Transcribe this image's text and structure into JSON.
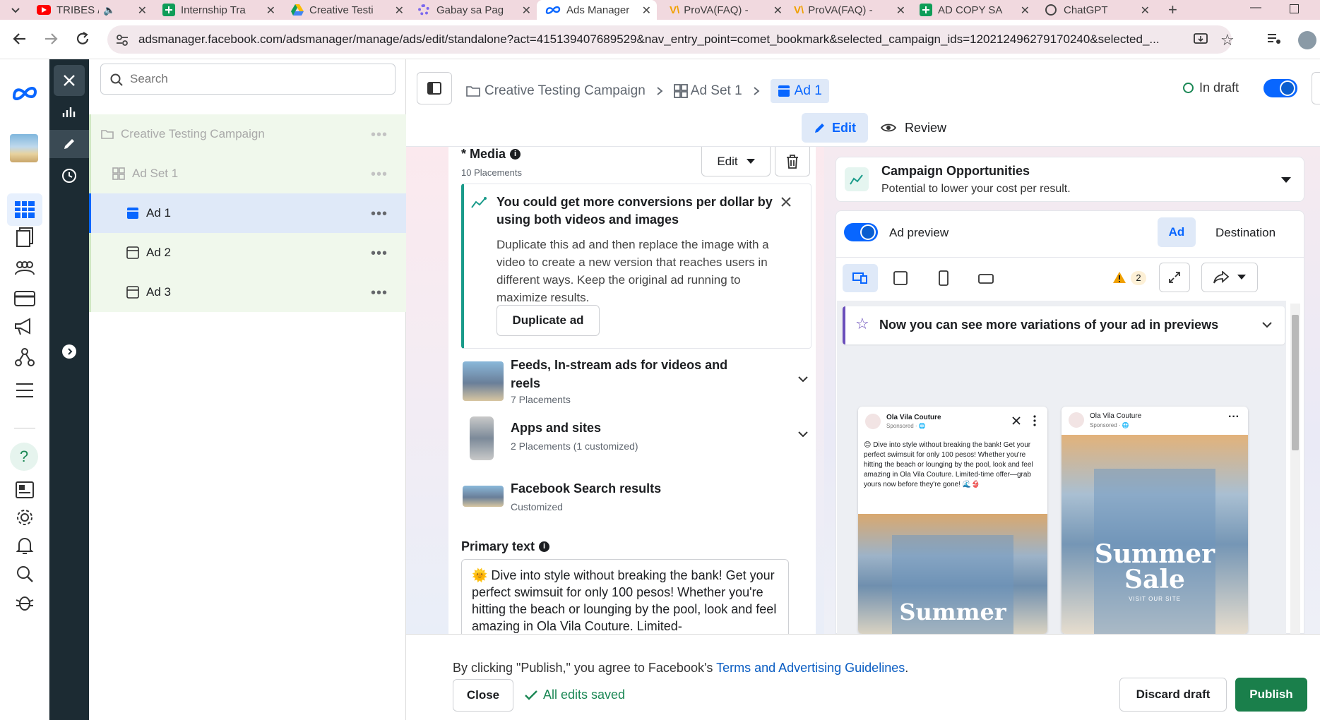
{
  "browser": {
    "tabs": [
      {
        "title": "TRIBES //",
        "icon": "youtube-icon",
        "color": "#ff0000"
      },
      {
        "title": "Internship Tra",
        "icon": "sheets-icon",
        "color": "#0f9d58"
      },
      {
        "title": "Creative Testi",
        "icon": "drive-icon",
        "color": "#fbbc04"
      },
      {
        "title": "Gabay sa Pag",
        "icon": "clickup-icon",
        "color": "#7b68ee"
      },
      {
        "title": "Ads Manager",
        "icon": "meta-icon",
        "color": "#0866ff"
      },
      {
        "title": "ProVA(FAQ) -",
        "icon": "prova-icon",
        "color": "#f0a000"
      },
      {
        "title": "ProVA(FAQ) -",
        "icon": "prova-icon",
        "color": "#f0a000"
      },
      {
        "title": "AD COPY SA",
        "icon": "sheets-icon",
        "color": "#0f9d58"
      },
      {
        "title": "ChatGPT",
        "icon": "chatgpt-icon",
        "color": "#444444"
      }
    ],
    "url": "adsmanager.facebook.com/adsmanager/manage/ads/edit/standalone?act=415139407689529&nav_entry_point=comet_bookmark&selected_campaign_ids=120212496279170240&selected_..."
  },
  "tree": {
    "search_placeholder": "Search",
    "campaign": "Creative Testing Campaign",
    "adset": "Ad Set 1",
    "ads": [
      "Ad 1",
      "Ad 2",
      "Ad 3"
    ],
    "more": "•••"
  },
  "breadcrumb": {
    "campaign": "Creative Testing Campaign",
    "adset": "Ad Set 1",
    "ad": "Ad 1",
    "status": "In draft"
  },
  "mode_tabs": {
    "edit": "Edit",
    "review": "Review"
  },
  "media": {
    "title": "* Media",
    "placements": "10 Placements",
    "edit_label": "Edit",
    "tip_title": "You could get more conversions per dollar by using both videos and images",
    "tip_body": "Duplicate this ad and then replace the image with a video to create a new version that reaches users in different ways. Keep the original ad running to maximize results.",
    "duplicate_label": "Duplicate ad",
    "groups": [
      {
        "title": "Feeds, In-stream ads for videos and reels",
        "sub": "7 Placements"
      },
      {
        "title": "Apps and sites",
        "sub": "2 Placements (1 customized)"
      },
      {
        "title": "Facebook Search results",
        "sub": "Customized"
      }
    ]
  },
  "primary_text": {
    "label": "Primary text",
    "value": "🌞 Dive into style without breaking the bank! Get your perfect swimsuit for only 100 pesos! Whether you're hitting the beach or lounging by the pool, look and feel amazing in Ola Vila Couture. Limited-"
  },
  "opportunities": {
    "title": "Campaign Opportunities",
    "sub": "Potential to lower your cost per result."
  },
  "preview": {
    "label": "Ad preview",
    "tab_ad": "Ad",
    "tab_destination": "Destination",
    "warning_count": "2",
    "banner": "Now you can see more variations of your ad in previews",
    "page_name": "Ola Vila Couture",
    "sponsored": "Sponsored · 🌐",
    "ad_text": "😊 Dive into style without breaking the bank! Get your perfect swimsuit for only 100 pesos! Whether you're hitting the beach or lounging by the pool, look and feel amazing in Ola Vila Couture. Limited-time offer—grab yours now before they're gone! 🌊👙",
    "creative_line1": "Summer",
    "creative_line2": "Sale",
    "creative_cta": "VISIT OUR SITE"
  },
  "footer": {
    "agree_prefix": "By clicking \"Publish,\" you agree to Facebook's ",
    "agree_link": "Terms and Advertising Guidelines",
    "agree_suffix": ".",
    "close": "Close",
    "saved": "All edits saved",
    "discard": "Discard draft",
    "publish": "Publish"
  }
}
